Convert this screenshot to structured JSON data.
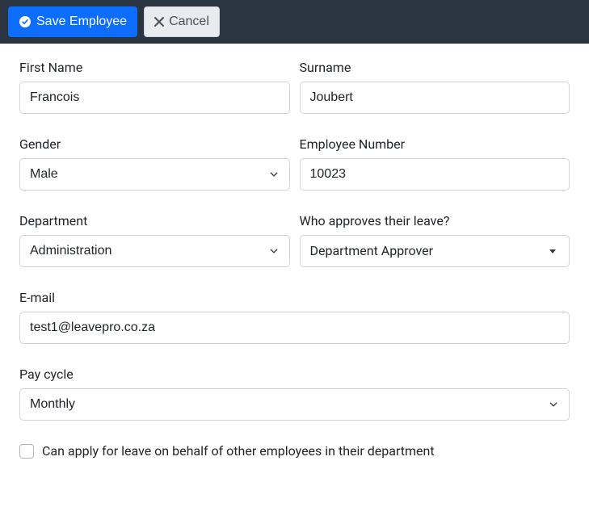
{
  "toolbar": {
    "save_label": "Save Employee",
    "cancel_label": "Cancel"
  },
  "form": {
    "first_name": {
      "label": "First Name",
      "value": "Francois"
    },
    "surname": {
      "label": "Surname",
      "value": "Joubert"
    },
    "gender": {
      "label": "Gender",
      "value": "Male"
    },
    "employee_number": {
      "label": "Employee Number",
      "value": "10023"
    },
    "department": {
      "label": "Department",
      "value": "Administration"
    },
    "approver": {
      "label": "Who approves their leave?",
      "value": "Department Approver"
    },
    "email": {
      "label": "E-mail",
      "value": "test1@leavepro.co.za"
    },
    "pay_cycle": {
      "label": "Pay cycle",
      "value": "Monthly"
    },
    "on_behalf": {
      "label": "Can apply for leave on behalf of other employees in their department",
      "checked": false
    }
  }
}
